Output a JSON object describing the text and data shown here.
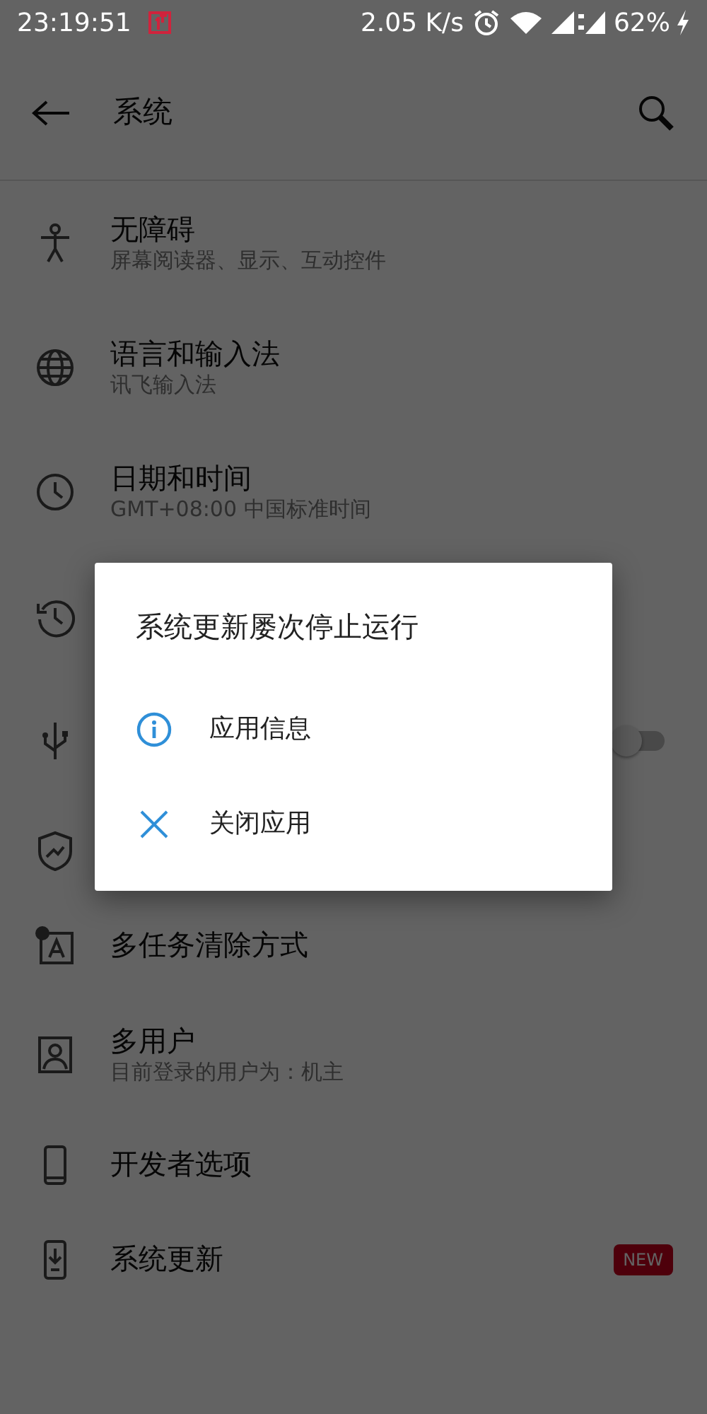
{
  "status_bar": {
    "time": "23:19:51",
    "speed": "2.05 K/s",
    "battery": "62%"
  },
  "toolbar": {
    "title": "系统"
  },
  "settings": [
    {
      "kind": "setting",
      "title": "无障碍",
      "subtitle": "屏幕阅读器、显示、互动控件"
    },
    {
      "kind": "setting",
      "title": "语言和输入法",
      "subtitle": "讯飞输入法"
    },
    {
      "kind": "setting",
      "title": "日期和时间",
      "subtitle": "GMT+08:00 中国标准时间"
    },
    {
      "kind": "covered"
    },
    {
      "kind": "covered",
      "toggle": {
        "on": false
      }
    },
    {
      "kind": "covered"
    },
    {
      "kind": "setting",
      "title": "多任务清除方式"
    },
    {
      "kind": "setting",
      "title": "多用户",
      "subtitle": "目前登录的用户为：机主"
    },
    {
      "kind": "setting",
      "title": "开发者选项"
    },
    {
      "kind": "setting",
      "title": "系统更新",
      "badge": "NEW"
    }
  ],
  "dialog": {
    "title": "系统更新屡次停止运行",
    "options": [
      {
        "kind": "info",
        "label": "应用信息"
      },
      {
        "kind": "close",
        "label": "关闭应用"
      }
    ]
  }
}
